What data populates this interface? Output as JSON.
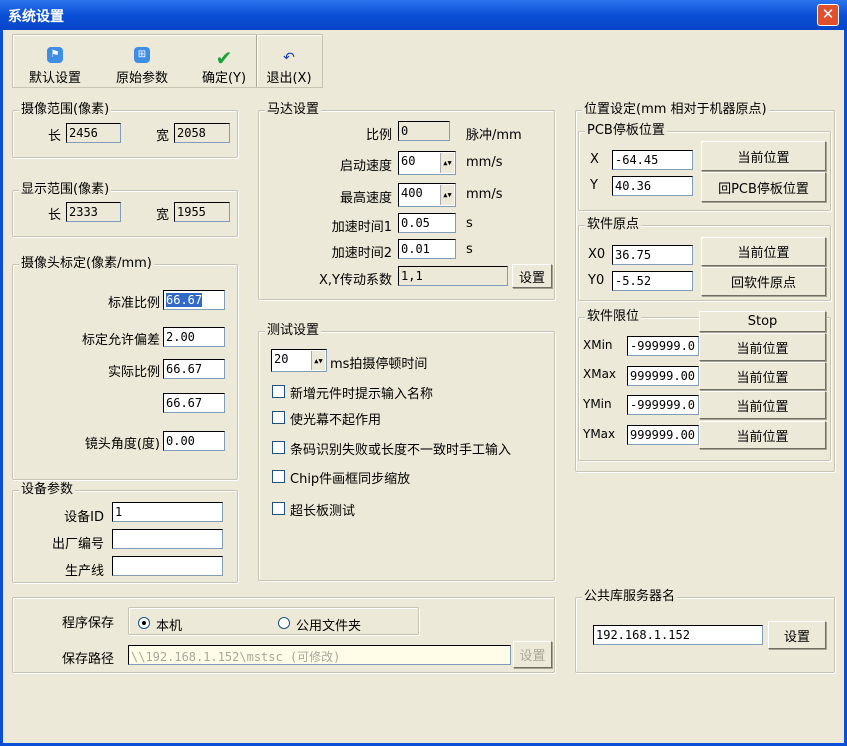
{
  "window": {
    "title": "系统设置",
    "close": "✕"
  },
  "toolbar": {
    "default": "默认设置",
    "original": "原始参数",
    "ok": "确定(Y)",
    "exit": "退出(X)"
  },
  "capture_range": {
    "title": "摄像范围(像素)",
    "len_label": "长",
    "len": "2456",
    "wid_label": "宽",
    "wid": "2058"
  },
  "display_range": {
    "title": "显示范围(像素)",
    "len_label": "长",
    "len": "2333",
    "wid_label": "宽",
    "wid": "1955"
  },
  "calib": {
    "title": "摄像头标定(像素/mm)",
    "std_label": "标准比例",
    "std": "66.67",
    "tol_label": "标定允许偏差",
    "tol": "2.00",
    "act_label": "实际比例",
    "act": "66.67",
    "act2": "66.67",
    "angle_label": "镜头角度(度)",
    "angle": "0.00"
  },
  "device": {
    "title": "设备参数",
    "id_label": "设备ID",
    "id": "1",
    "serial_label": "出厂编号",
    "serial": "",
    "line_label": "生产线",
    "line": ""
  },
  "motor": {
    "title": "马达设置",
    "ratio_label": "比例",
    "ratio": "0",
    "ratio_unit": "脉冲/mm",
    "start_label": "启动速度",
    "start": "60",
    "start_unit": "mm/s",
    "max_label": "最高速度",
    "max": "400",
    "max_unit": "mm/s",
    "acc1_label": "加速时间1",
    "acc1": "0.05",
    "acc1_unit": "s",
    "acc2_label": "加速时间2",
    "acc2": "0.01",
    "acc2_unit": "s",
    "xy_label": "X,Y传动系数",
    "xy": "1,1",
    "set": "设置"
  },
  "test": {
    "title": "测试设置",
    "delay": "20",
    "delay_label": "ms拍摄停顿时间",
    "checks": [
      "新增元件时提示输入名称",
      "使光幕不起作用",
      "条码识别失败或长度不一致时手工输入",
      "Chip件画框同步缩放",
      "超长板测试"
    ]
  },
  "position": {
    "title": "位置设定(mm 相对于机器原点)",
    "pcb": {
      "title": "PCB停板位置",
      "x_label": "X",
      "x": "-64.45",
      "y_label": "Y",
      "y": "40.36",
      "cur": "当前位置",
      "go": "回PCB停板位置"
    },
    "origin": {
      "title": "软件原点",
      "x_label": "X0",
      "x": "36.75",
      "y_label": "Y0",
      "y": "-5.52",
      "cur": "当前位置",
      "go": "回软件原点"
    },
    "limit": {
      "title": "软件限位",
      "stop": "Stop",
      "cur": "当前位置",
      "xmin_label": "XMin",
      "xmin": "-999999.0",
      "xmax_label": "XMax",
      "xmax": "999999.00",
      "ymin_label": "YMin",
      "ymin": "-999999.0",
      "ymax_label": "YMax",
      "ymax": "999999.00"
    }
  },
  "save": {
    "label": "程序保存",
    "local": "本机",
    "shared": "公用文件夹",
    "path_label": "保存路径",
    "path": "\\\\192.168.1.152\\mstsc (可修改)",
    "set": "设置"
  },
  "server": {
    "title": "公共库服务器名",
    "ip": "192.168.1.152",
    "set": "设置"
  }
}
